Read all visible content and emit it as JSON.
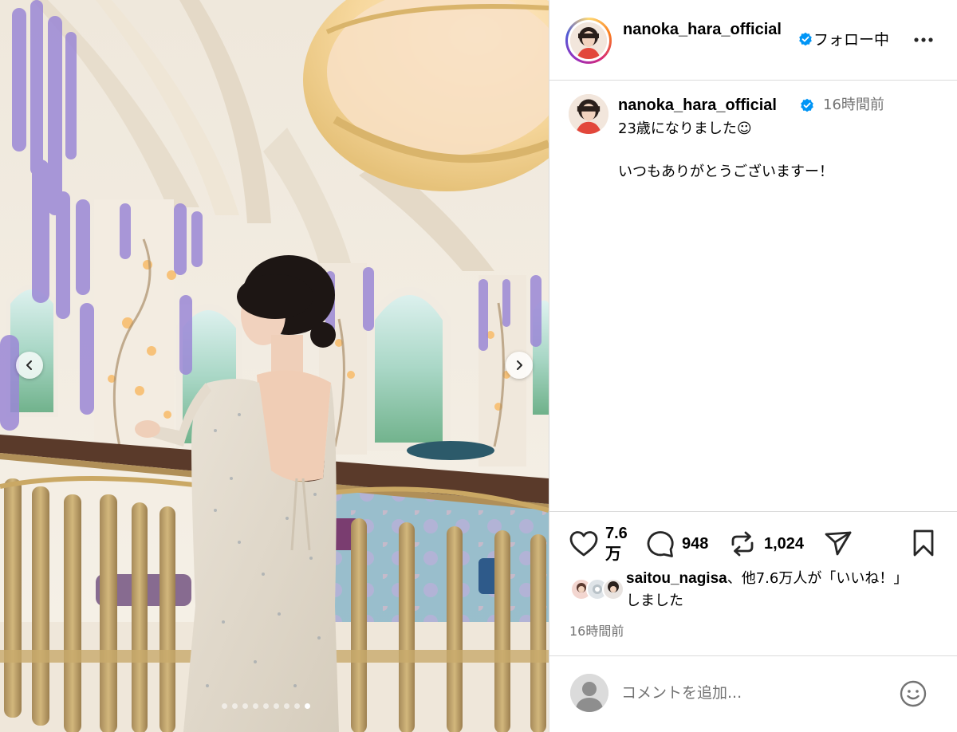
{
  "post": {
    "username": "nanoka_hara_official",
    "follow_status": "フォロー中",
    "time_ago": "16時間前",
    "caption_line1": "23歳になりました☺",
    "caption_line2": "いつもありがとうございますー！",
    "like_count": "7.6万",
    "comment_count": "948",
    "repost_count": "1,024",
    "liked_by_user": "saitou_nagisa",
    "liked_by_rest": "、他7.6万人が「いいね！」しました",
    "timestamp": "16時間前"
  },
  "carousel": {
    "total_slides": 9,
    "active_slide": 9
  },
  "comment": {
    "placeholder": "コメントを追加..."
  },
  "icons": {
    "verified": "verified-badge-icon",
    "more": "more-options-icon",
    "like": "heart-icon",
    "comment": "comment-bubble-icon",
    "repost": "repost-icon",
    "share": "share-paper-plane-icon",
    "save": "bookmark-icon",
    "emoji": "emoji-icon",
    "prev": "chevron-left-icon",
    "next": "chevron-right-icon"
  },
  "colors": {
    "verified": "#0095f6",
    "secondary_text": "#737373",
    "divider": "#dbdbdb"
  }
}
